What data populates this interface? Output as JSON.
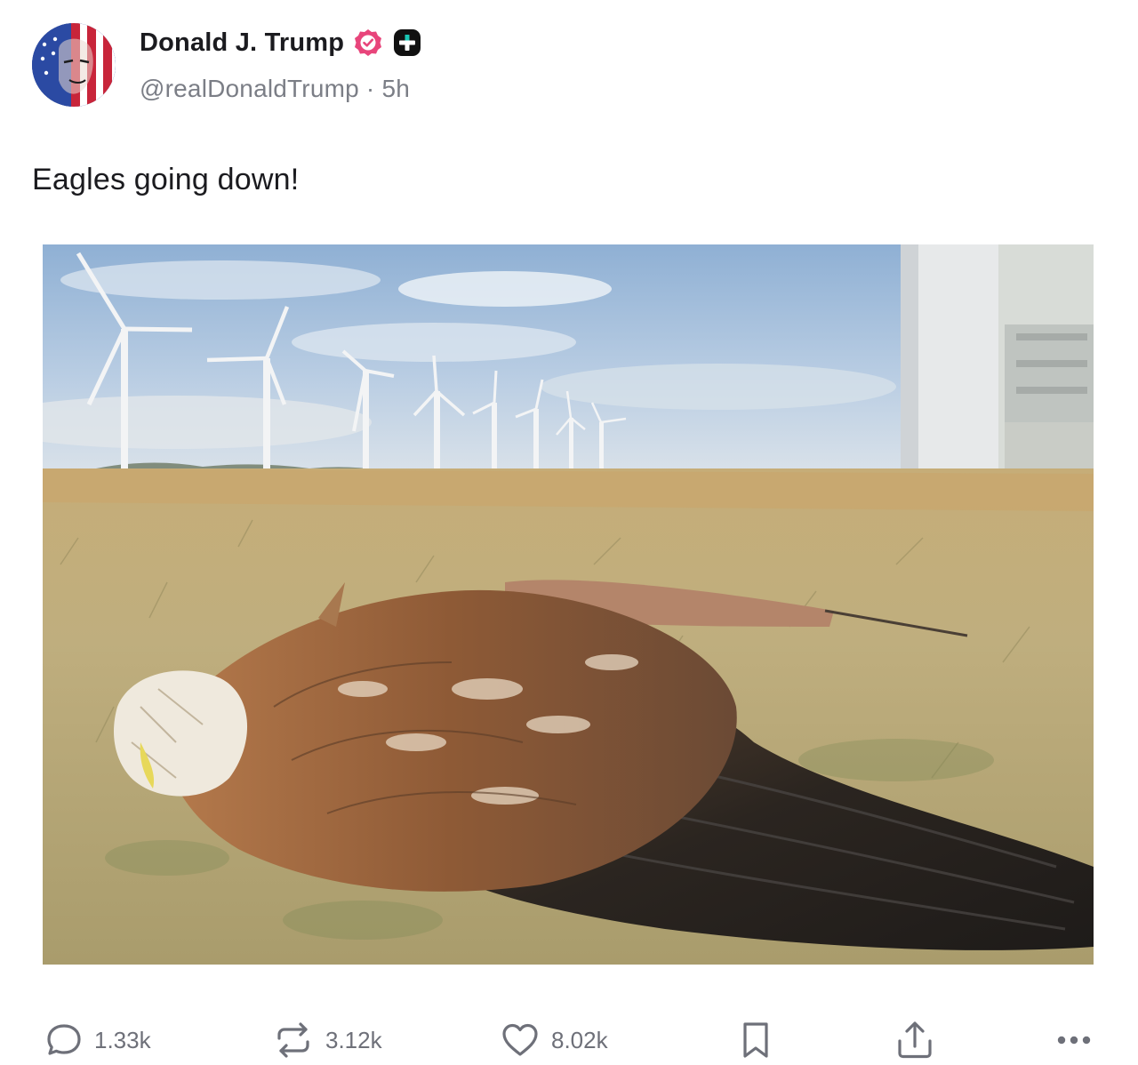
{
  "author": {
    "display_name": "Donald J. Trump",
    "handle": "@realDonaldTrump",
    "separator": "·",
    "time": "5h",
    "avatar_icon": "avatar-flag-portrait",
    "verified_icon": "verified-badge-icon",
    "verified_color": "#e8457b",
    "plus_icon": "plus-badge-icon"
  },
  "post": {
    "text": "Eagles going down!",
    "media_description_icon": "photo"
  },
  "actions": {
    "reply": {
      "icon": "reply-icon",
      "count": "1.33k"
    },
    "repost": {
      "icon": "repost-icon",
      "count": "3.12k"
    },
    "like": {
      "icon": "heart-icon",
      "count": "8.02k"
    },
    "bookmark": {
      "icon": "bookmark-icon"
    },
    "share": {
      "icon": "share-icon"
    },
    "more": {
      "icon": "more-icon"
    }
  },
  "colors": {
    "text_primary": "#1b1b1f",
    "text_secondary": "#7b7e86",
    "icon_gray": "#6e7079"
  }
}
